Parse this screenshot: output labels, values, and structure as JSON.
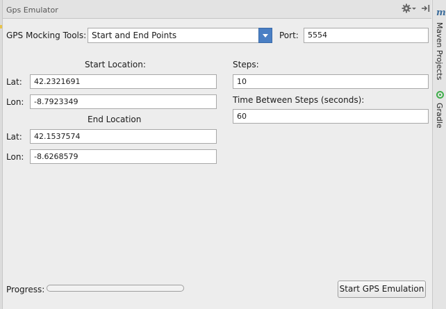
{
  "window": {
    "title": "Gps Emulator"
  },
  "header": {
    "settings_icon": "gear-icon",
    "hide_icon": "hide-panel-icon"
  },
  "right_stripe": {
    "maven_label": "Maven Projects",
    "gradle_label": "Gradle"
  },
  "tools": {
    "label": "GPS Mocking Tools:",
    "selected": "Start and End Points",
    "port_label": "Port:",
    "port_value": "5554"
  },
  "start": {
    "heading": "Start Location:",
    "lat_label": "Lat:",
    "lat_value": "42.2321691",
    "lon_label": "Lon:",
    "lon_value": "-8.7923349"
  },
  "end": {
    "heading": "End Location",
    "lat_label": "Lat:",
    "lat_value": "42.1537574",
    "lon_label": "Lon:",
    "lon_value": "-8.6268579"
  },
  "steps": {
    "label": "Steps:",
    "value": "10"
  },
  "time": {
    "label": "Time Between Steps (seconds):",
    "value": "60"
  },
  "progress": {
    "label": "Progress:",
    "value": 0
  },
  "actions": {
    "start_label": "Start GPS Emulation"
  },
  "colors": {
    "accent": "#4a7fc4",
    "maven": "#3e6e9c",
    "gradle": "#3fae4b"
  }
}
